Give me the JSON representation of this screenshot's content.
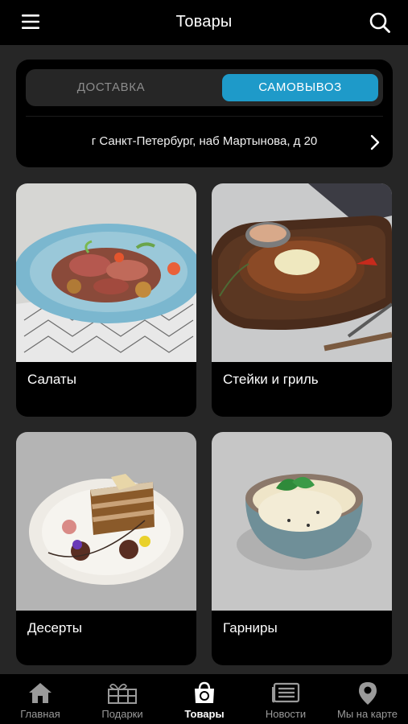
{
  "header": {
    "title": "Товары",
    "menu_icon": "menu-icon",
    "search_icon": "search-icon"
  },
  "delivery": {
    "options": [
      "ДОСТАВКА",
      "САМОВЫВОЗ"
    ],
    "selected": "САМОВЫВОЗ",
    "address": "г Санкт-Петербург, наб Мартынова, д 20"
  },
  "categories": [
    {
      "label": "Салаты"
    },
    {
      "label": "Стейки и гриль"
    },
    {
      "label": "Десерты"
    },
    {
      "label": "Гарниры"
    }
  ],
  "tabbar": {
    "items": [
      {
        "label": "Главная",
        "icon": "home-icon"
      },
      {
        "label": "Подарки",
        "icon": "gift-icon"
      },
      {
        "label": "Товары",
        "icon": "shopping-bag-icon"
      },
      {
        "label": "Новости",
        "icon": "news-icon"
      },
      {
        "label": "Мы на карте",
        "icon": "map-pin-icon"
      }
    ],
    "active": "Товары"
  },
  "colors": {
    "accent": "#1e9ac9",
    "background": "#262626",
    "surface": "#000000"
  }
}
